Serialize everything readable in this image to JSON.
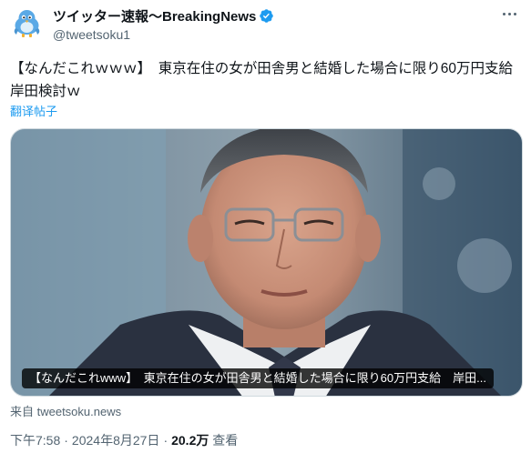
{
  "author": {
    "display_name": "ツイッター速報〜BreakingNews",
    "handle": "@tweetsoku1",
    "verified": true,
    "avatar_icon": "bird-avatar-icon"
  },
  "tweet": {
    "text": "【なんだこれｗｗｗ】　東京在住の女が田舎男と結婚した場合に限り60万円支給　岸田検討ｗ",
    "translate_label": "翻译帖子"
  },
  "card": {
    "caption": "【なんだこれwww】　東京在住の女が田舎男と結婚した場合に限り60万円支給　岸田...",
    "source_label": "来自 tweetsoku.news"
  },
  "meta": {
    "time": "下午7:58",
    "date": "2024年8月27日",
    "views_count": "20.2万",
    "views_label": "查看"
  },
  "colors": {
    "accent": "#1d9bf0",
    "secondary_text": "#536471",
    "primary_text": "#0f1419",
    "avatar_bird": "#5aa9e6"
  }
}
